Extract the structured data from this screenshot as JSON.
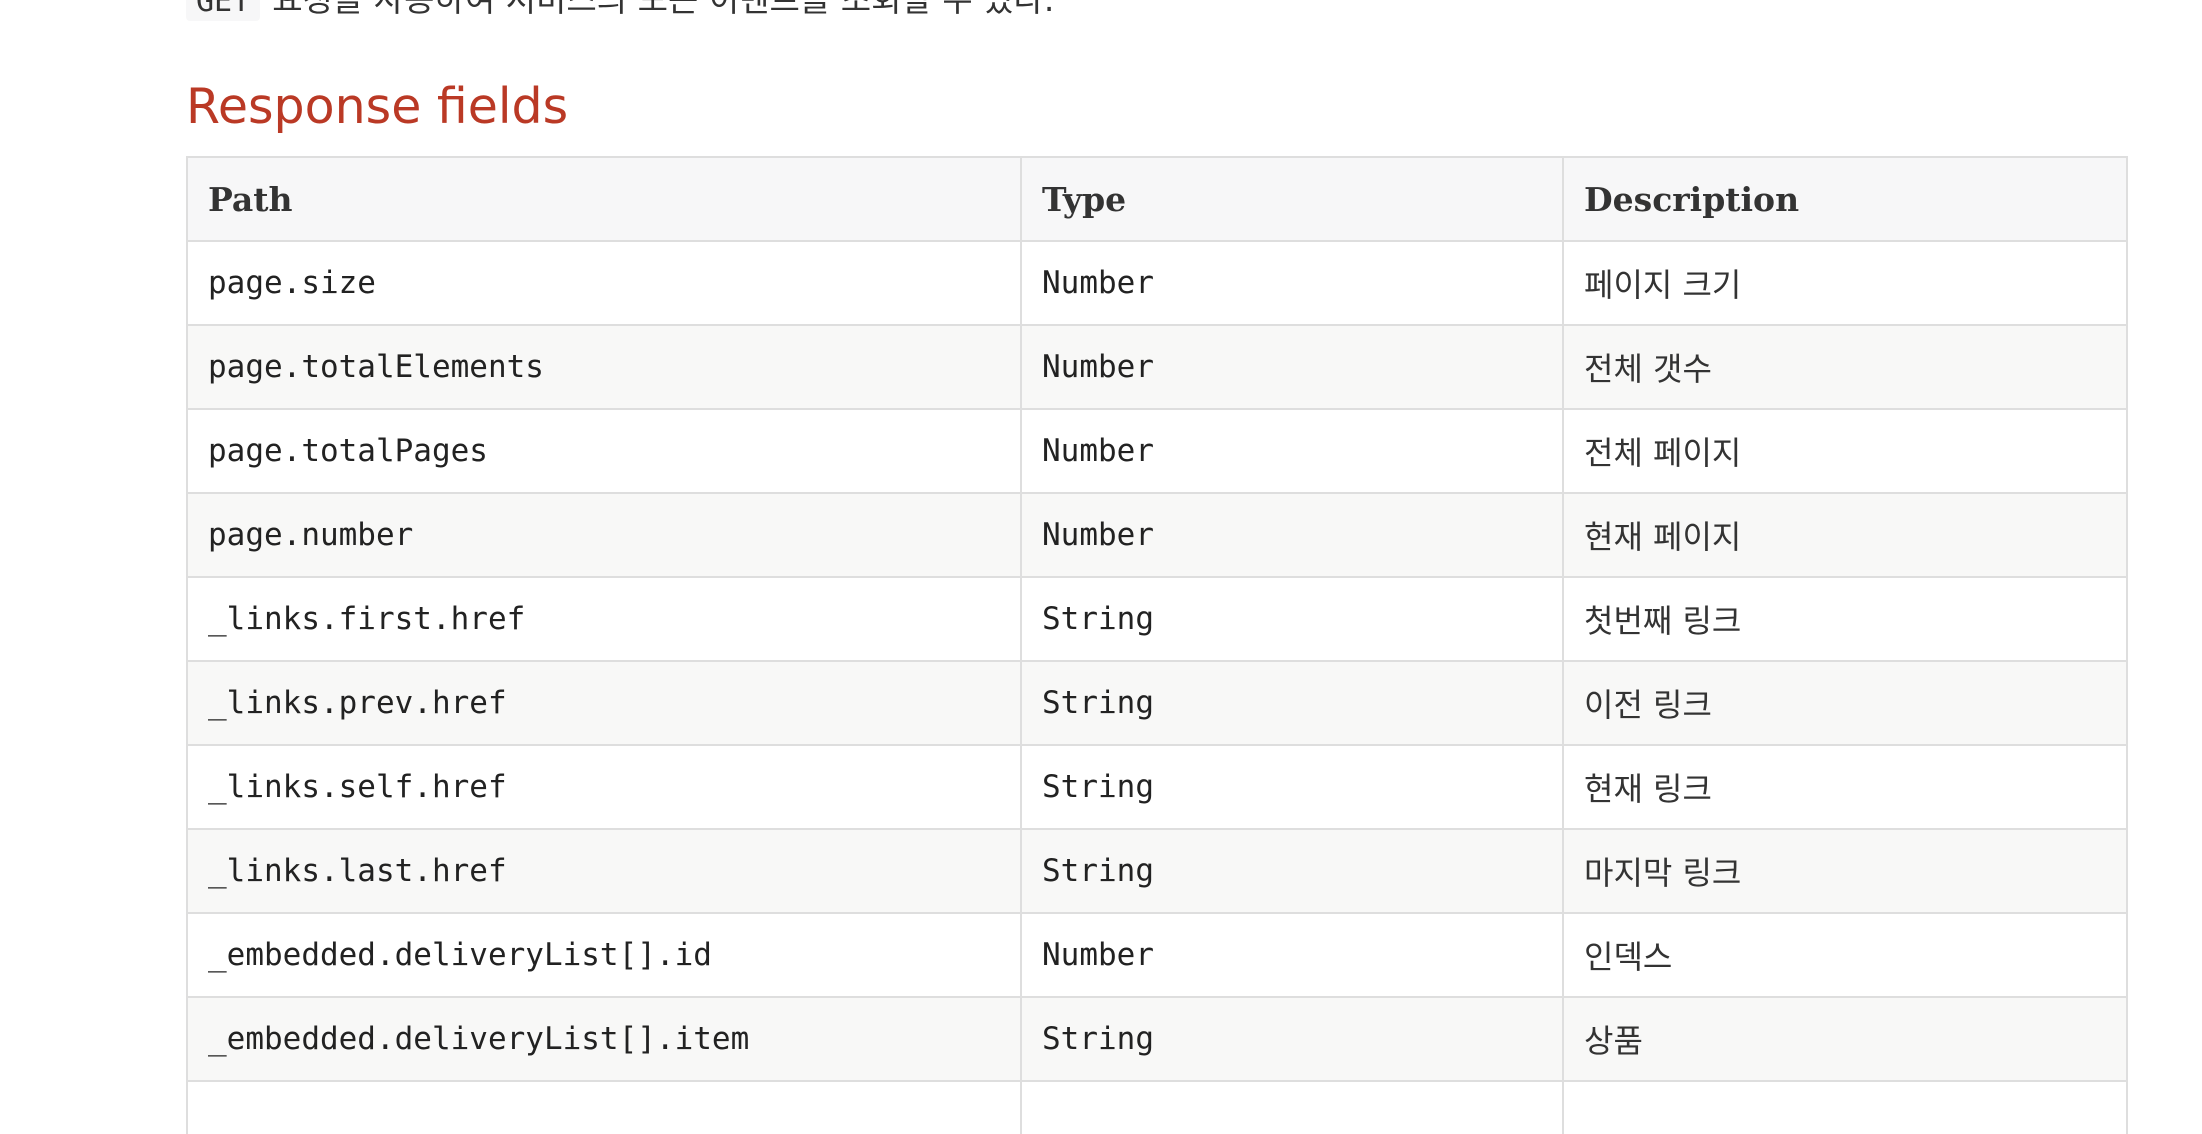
{
  "intro": {
    "method": "GET",
    "text": "요청을 사용하여 서비스의 모든 이벤트를 조회할 수 있다."
  },
  "section": {
    "title": "Response fields"
  },
  "table": {
    "headers": {
      "path": "Path",
      "type": "Type",
      "description": "Description"
    },
    "rows": [
      {
        "path": "page.size",
        "type": "Number",
        "description": "페이지 크기"
      },
      {
        "path": "page.totalElements",
        "type": "Number",
        "description": "전체 갯수"
      },
      {
        "path": "page.totalPages",
        "type": "Number",
        "description": "전체 페이지"
      },
      {
        "path": "page.number",
        "type": "Number",
        "description": "현재 페이지"
      },
      {
        "path": "_links.first.href",
        "type": "String",
        "description": "첫번째 링크"
      },
      {
        "path": "_links.prev.href",
        "type": "String",
        "description": "이전 링크"
      },
      {
        "path": "_links.self.href",
        "type": "String",
        "description": "현재 링크"
      },
      {
        "path": "_links.last.href",
        "type": "String",
        "description": "마지막 링크"
      },
      {
        "path": "_embedded.deliveryList[].id",
        "type": "Number",
        "description": "인덱스"
      },
      {
        "path": "_embedded.deliveryList[].item",
        "type": "String",
        "description": "상품"
      },
      {
        "path": "",
        "type": "",
        "description": ""
      }
    ]
  }
}
